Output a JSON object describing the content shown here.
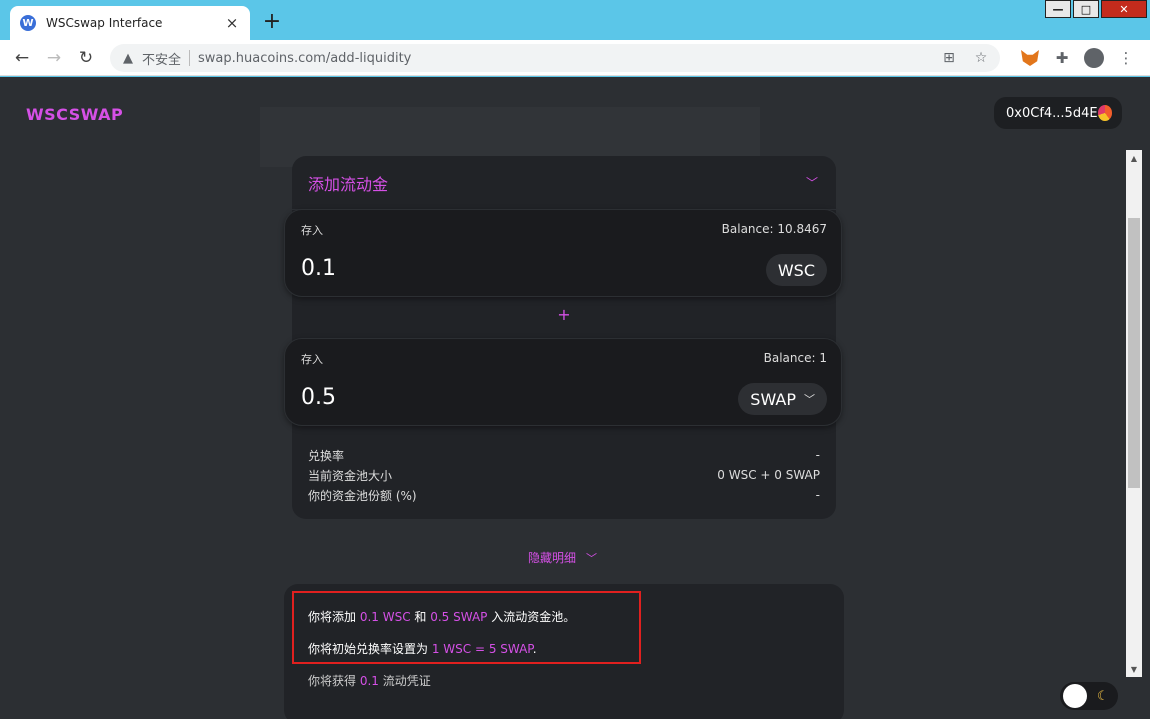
{
  "browser": {
    "tab_title": "WSCswap Interface",
    "tab_favicon_letter": "W",
    "insecure_label": "不安全",
    "url": "swap.huacoins.com/add-liquidity"
  },
  "header": {
    "logo": "WSCSWAP",
    "wallet_address": "0x0Cf4...5d4E"
  },
  "card": {
    "title": "添加流动金"
  },
  "deposit1": {
    "label": "存入",
    "balance": "Balance: 10.8467",
    "value": "0.1",
    "token": "WSC"
  },
  "deposit2": {
    "label": "存入",
    "balance": "Balance: 1",
    "value": "0.5",
    "token": "SWAP"
  },
  "plus_symbol": "+",
  "info": {
    "rate_label": "兑换率",
    "rate_value": "-",
    "pool_label": "当前资金池大小",
    "pool_value": "0 WSC + 0 SWAP",
    "share_label": "你的资金池份额 (%)",
    "share_value": "-"
  },
  "toggle_details": "隐藏明细",
  "summary": {
    "line1_prefix": "你将添加 ",
    "line1_amount1": "0.1 WSC",
    "line1_and": " 和 ",
    "line1_amount2": "0.5 SWAP",
    "line1_suffix": " 入流动资金池。",
    "line2_prefix": "你将初始兑换率设置为 ",
    "line2_rate": "1 WSC = 5 SWAP",
    "line2_suffix": ".",
    "line3_prefix": "你将获得 ",
    "line3_amount": "0.1",
    "line3_suffix": " 流动凭证"
  },
  "icons": {
    "back": "back-arrow-icon",
    "forward": "forward-arrow-icon",
    "reload": "reload-icon",
    "warning": "warning-icon",
    "translate": "translate-icon",
    "star": "star-icon",
    "metamask": "metamask-fox-icon",
    "extensions": "puzzle-icon",
    "profile": "profile-icon",
    "menu": "kebab-menu-icon",
    "moon": "moon-icon"
  },
  "colors": {
    "accent": "#d550e6",
    "background": "#2c2f33",
    "card": "#212327",
    "highlight_border": "#e0201f"
  }
}
